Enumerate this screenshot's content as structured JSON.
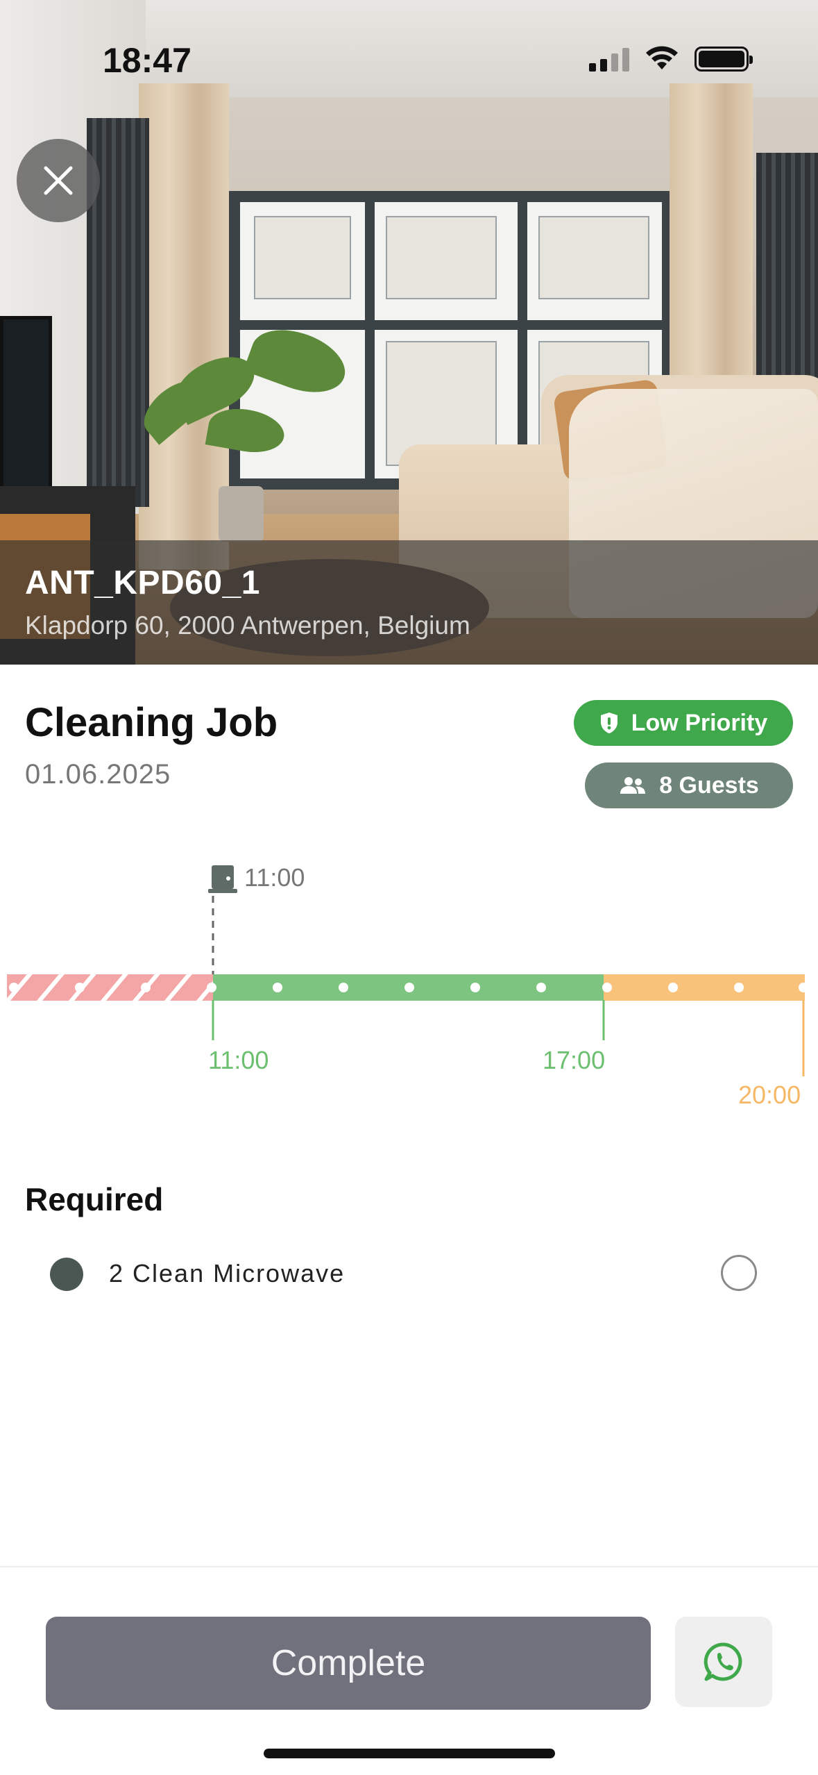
{
  "status_bar": {
    "time": "18:47"
  },
  "property": {
    "code": "ANT_KPD60_1",
    "address": "Klapdorp 60, 2000 Antwerpen, Belgium"
  },
  "job": {
    "title": "Cleaning Job",
    "date": "01.06.2025",
    "priority_label": "Low Priority",
    "guests_label": "8 Guests"
  },
  "timeline": {
    "checkout_time": "11:00",
    "start_label": "11:00",
    "end_label": "17:00",
    "checkin_label": "20:00",
    "colors": {
      "blocked": "#f4a6a6",
      "window": "#7cc47f",
      "after": "#f9c27b",
      "start_text": "#6cbf6f",
      "checkin_text": "#f7b866"
    }
  },
  "required": {
    "title": "Required",
    "tasks": [
      {
        "label": "2 Clean Microwave",
        "checked": false
      }
    ]
  },
  "footer": {
    "complete_label": "Complete"
  },
  "icons": {
    "close": "close-icon",
    "priority": "shield-icon",
    "guests": "people-icon",
    "door": "door-icon",
    "whatsapp": "whatsapp-icon"
  }
}
